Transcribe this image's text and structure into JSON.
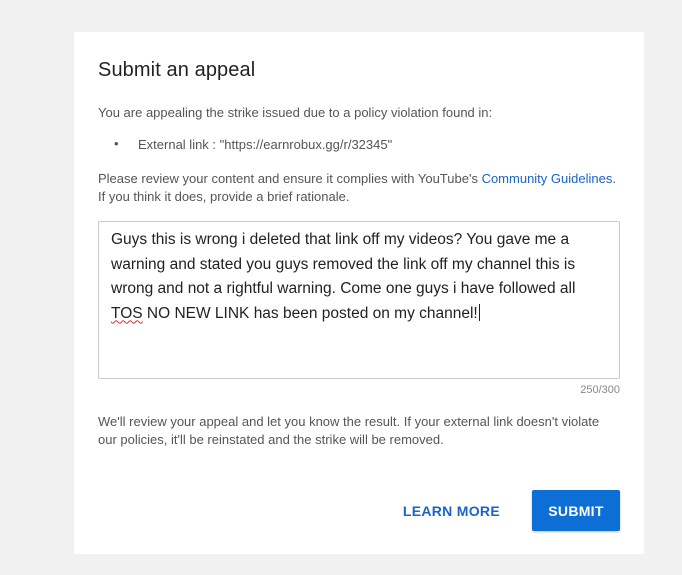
{
  "dialog": {
    "title": "Submit an appeal",
    "intro": "You are appealing the strike issued due to a policy violation found in:",
    "violation_item": "External link : \"https://earnrobux.gg/r/32345\"",
    "review_prefix": "Please review your content and ensure it complies with YouTube's ",
    "guidelines_link": "Community Guidelines",
    "review_suffix": ". If you think it does, provide a brief rationale.",
    "rationale": {
      "text_before": "Guys this is wrong i deleted that link off my videos? You gave me a warning and stated you guys removed the link off my channel this is wrong and not a rightful warning. Come one guys i have followed all ",
      "misspelled": "TOS",
      "text_after": " NO NEW LINK has been posted on my channel!",
      "char_count": "250/300"
    },
    "result_text": "We'll review your appeal and let you know the result. If your external link doesn't violate our policies, it'll be reinstated and the strike will be removed.",
    "buttons": {
      "learn_more": "LEARN MORE",
      "submit": "SUBMIT"
    }
  },
  "colors": {
    "page_background": "#f1f1f1",
    "link": "#1a64c8",
    "submit_background": "#0d6fd6"
  }
}
